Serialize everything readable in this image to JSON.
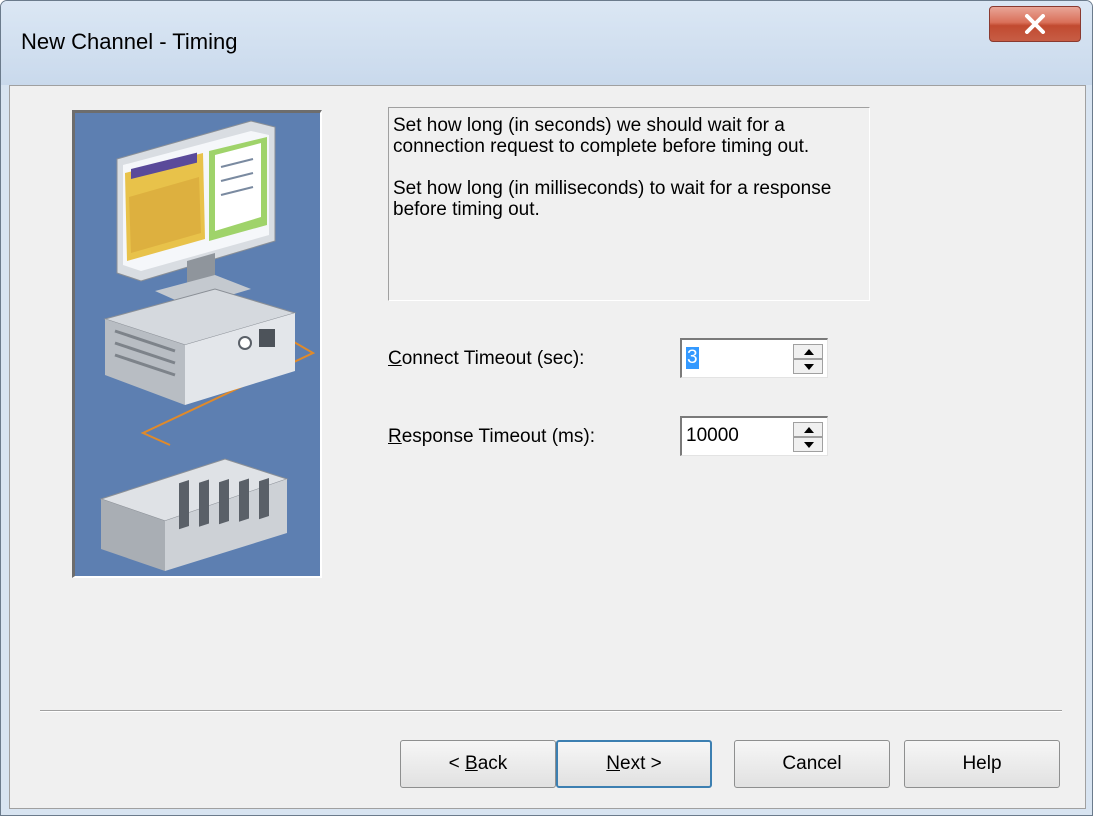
{
  "window": {
    "title": "New Channel - Timing",
    "close_glyph": "X"
  },
  "description": {
    "paragraph1": "Set how long (in seconds) we should wait for a connection request to complete before timing out.",
    "paragraph2": "Set how long (in milliseconds) to wait for a response before timing out."
  },
  "fields": {
    "connect_timeout": {
      "label_access_key": "C",
      "label_rest": "onnect Timeout (sec):",
      "value": "3"
    },
    "response_timeout": {
      "label_access_key": "R",
      "label_rest": "esponse Timeout (ms):",
      "value": "10000"
    }
  },
  "buttons": {
    "back": {
      "prefix": "< ",
      "access_key": "B",
      "rest": "ack"
    },
    "next": {
      "access_key": "N",
      "rest": "ext >"
    },
    "cancel": {
      "label": "Cancel"
    },
    "help": {
      "label": "Help"
    }
  },
  "icons": {
    "close": "close-icon",
    "spin_up": "arrow-up-icon",
    "spin_down": "arrow-down-icon",
    "illustration": "computer-plc-illustration"
  },
  "colors": {
    "dialog_background": "#f0f0f0",
    "illustration_background": "#5d7fb1",
    "close_button": "#c75d45",
    "selection_highlight": "#3399ff",
    "default_button_border": "#3c7fb1"
  }
}
